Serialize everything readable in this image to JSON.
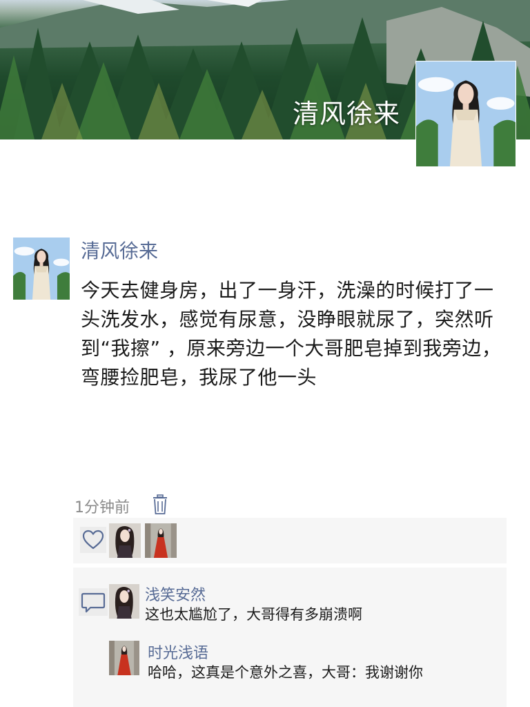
{
  "profile": {
    "cover_name": "清风徐来",
    "cover_image": "mountain-forest-cover",
    "avatar": "woman-in-white-dress-avatar"
  },
  "post": {
    "author": "清风徐来",
    "text": "今天去健身房，出了一身汗，洗澡的时候打了一头洗发水，感觉有尿意，没睁眼就尿了，突然听到“我擦” ，原来旁边一个大哥肥皂掉到我旁边，弯腰捡肥皂，我尿了他一头",
    "time": "1分钟前",
    "delete_icon": "trash-icon"
  },
  "likes": {
    "icon": "heart-icon",
    "users": [
      {
        "avatar": "dark-hair-girl-avatar"
      },
      {
        "avatar": "red-dress-girl-avatar"
      }
    ]
  },
  "comments": {
    "icon": "chat-bubble-icon",
    "items": [
      {
        "author": "浅笑安然",
        "text": "这也太尴尬了，大哥得有多崩溃啊",
        "avatar": "dark-hair-girl-avatar"
      },
      {
        "author": "时光浅语",
        "text": "哈哈，这真是个意外之喜，大哥：我谢谢你",
        "avatar": "red-dress-girl-avatar"
      }
    ]
  },
  "colors": {
    "name_blue": "#576b95",
    "panel_gray": "#f6f6f6",
    "text": "#1a1a1a",
    "time_gray": "#8a8a8a"
  }
}
